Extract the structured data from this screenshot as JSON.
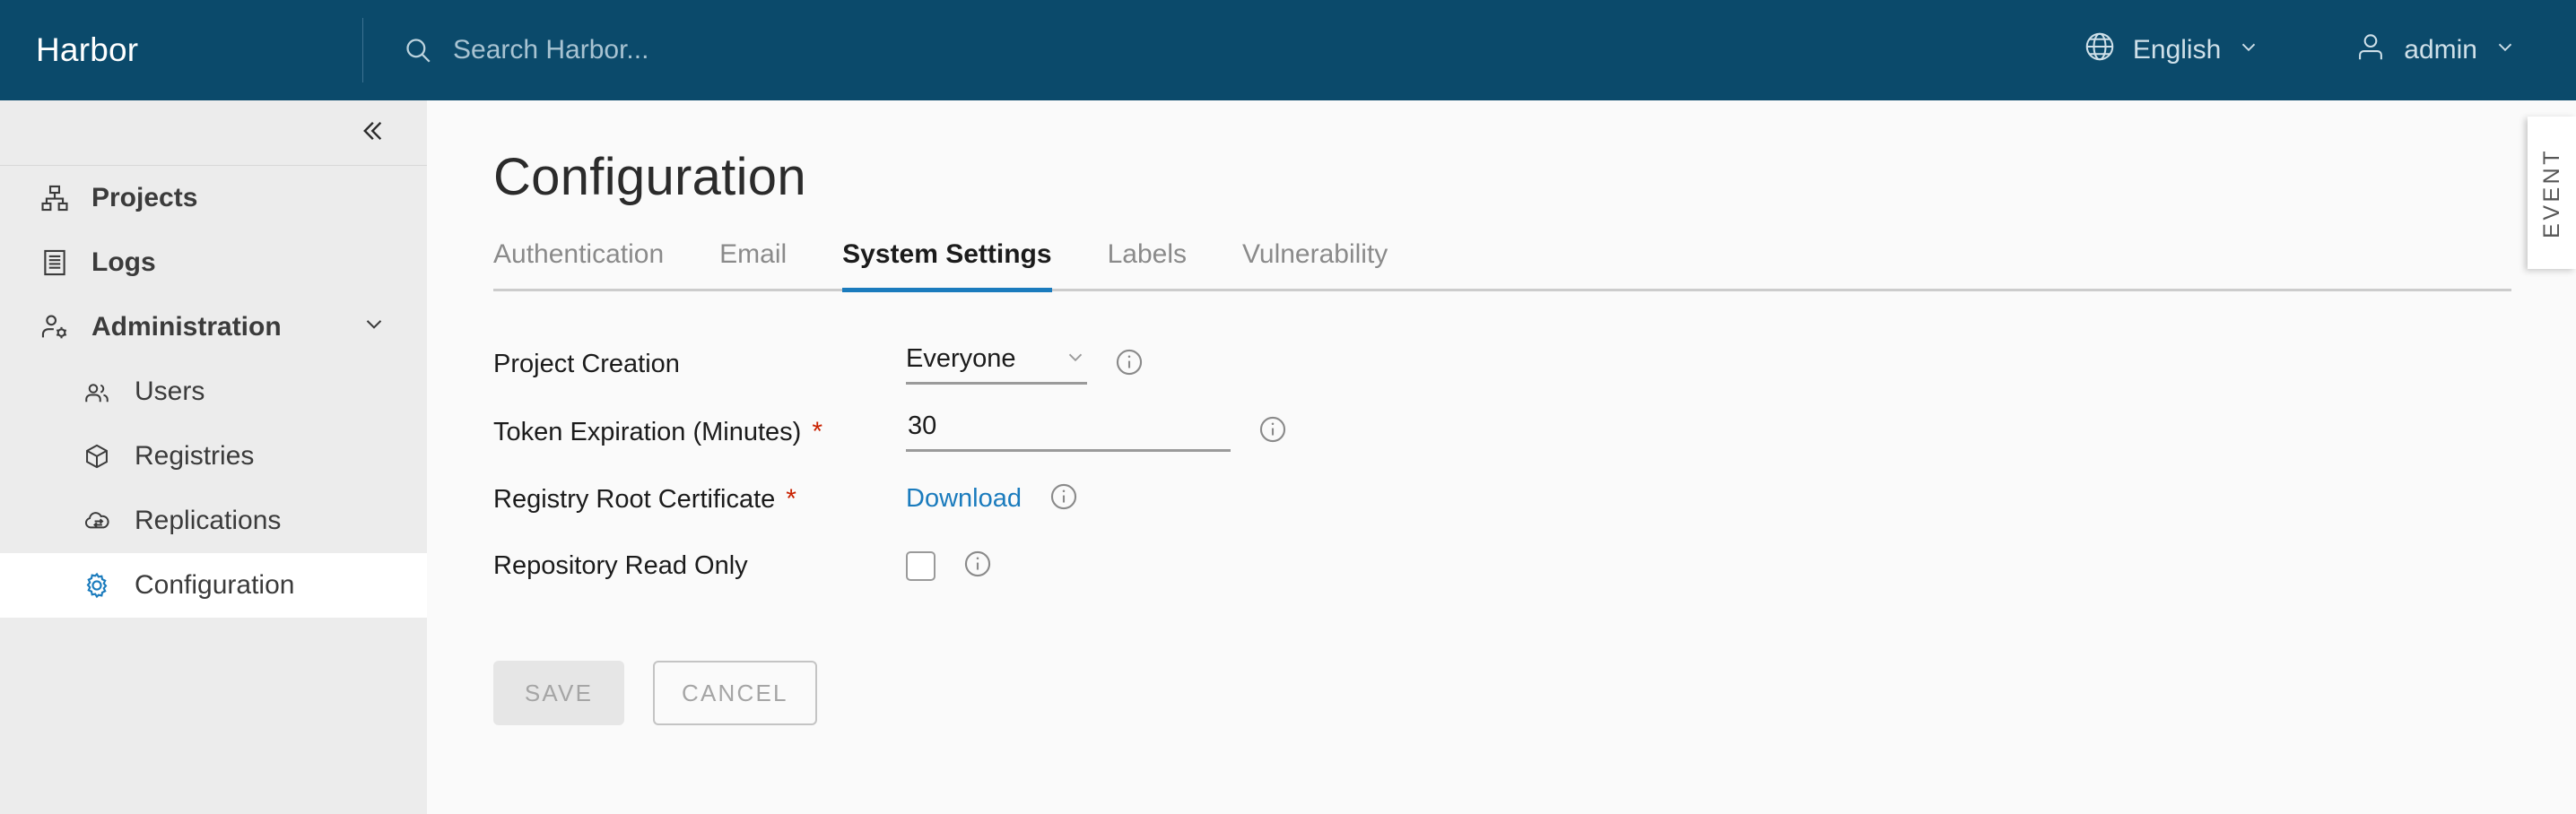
{
  "header": {
    "brand": "Harbor",
    "search": {
      "placeholder": "Search Harbor...",
      "value": ""
    },
    "language": "English",
    "user": "admin"
  },
  "sidebar": {
    "items": [
      {
        "label": "Projects",
        "icon": "projects-icon",
        "level": "top",
        "selected": false
      },
      {
        "label": "Logs",
        "icon": "logs-icon",
        "level": "top",
        "selected": false
      },
      {
        "label": "Administration",
        "icon": "administration-icon",
        "level": "top",
        "selected": false,
        "expanded": true
      },
      {
        "label": "Users",
        "icon": "users-icon",
        "level": "sub",
        "selected": false
      },
      {
        "label": "Registries",
        "icon": "registries-icon",
        "level": "sub",
        "selected": false
      },
      {
        "label": "Replications",
        "icon": "replications-icon",
        "level": "sub",
        "selected": false
      },
      {
        "label": "Configuration",
        "icon": "configuration-icon",
        "level": "sub",
        "selected": true
      }
    ]
  },
  "main": {
    "title": "Configuration",
    "tabs": [
      {
        "label": "Authentication",
        "active": false
      },
      {
        "label": "Email",
        "active": false
      },
      {
        "label": "System Settings",
        "active": true
      },
      {
        "label": "Labels",
        "active": false
      },
      {
        "label": "Vulnerability",
        "active": false
      }
    ],
    "fields": {
      "project_creation": {
        "label": "Project Creation",
        "value": "Everyone",
        "required": false
      },
      "token_expiration": {
        "label": "Token Expiration (Minutes)",
        "value": "30",
        "required": true,
        "required_marker": "*"
      },
      "registry_root_certificate": {
        "label": "Registry Root Certificate",
        "link": "Download",
        "required": true,
        "required_marker": "*"
      },
      "repository_read_only": {
        "label": "Repository Read Only",
        "checked": false,
        "required": false
      }
    },
    "buttons": {
      "save": "SAVE",
      "cancel": "CANCEL"
    }
  },
  "event_tab": {
    "label": "EVENT"
  },
  "colors": {
    "header_bg": "#0b4a6b",
    "sidebar_bg": "#ececec",
    "content_bg": "#fafafa",
    "accent": "#1a7bbd",
    "required": "#c92100",
    "link": "#1a7bbd"
  }
}
